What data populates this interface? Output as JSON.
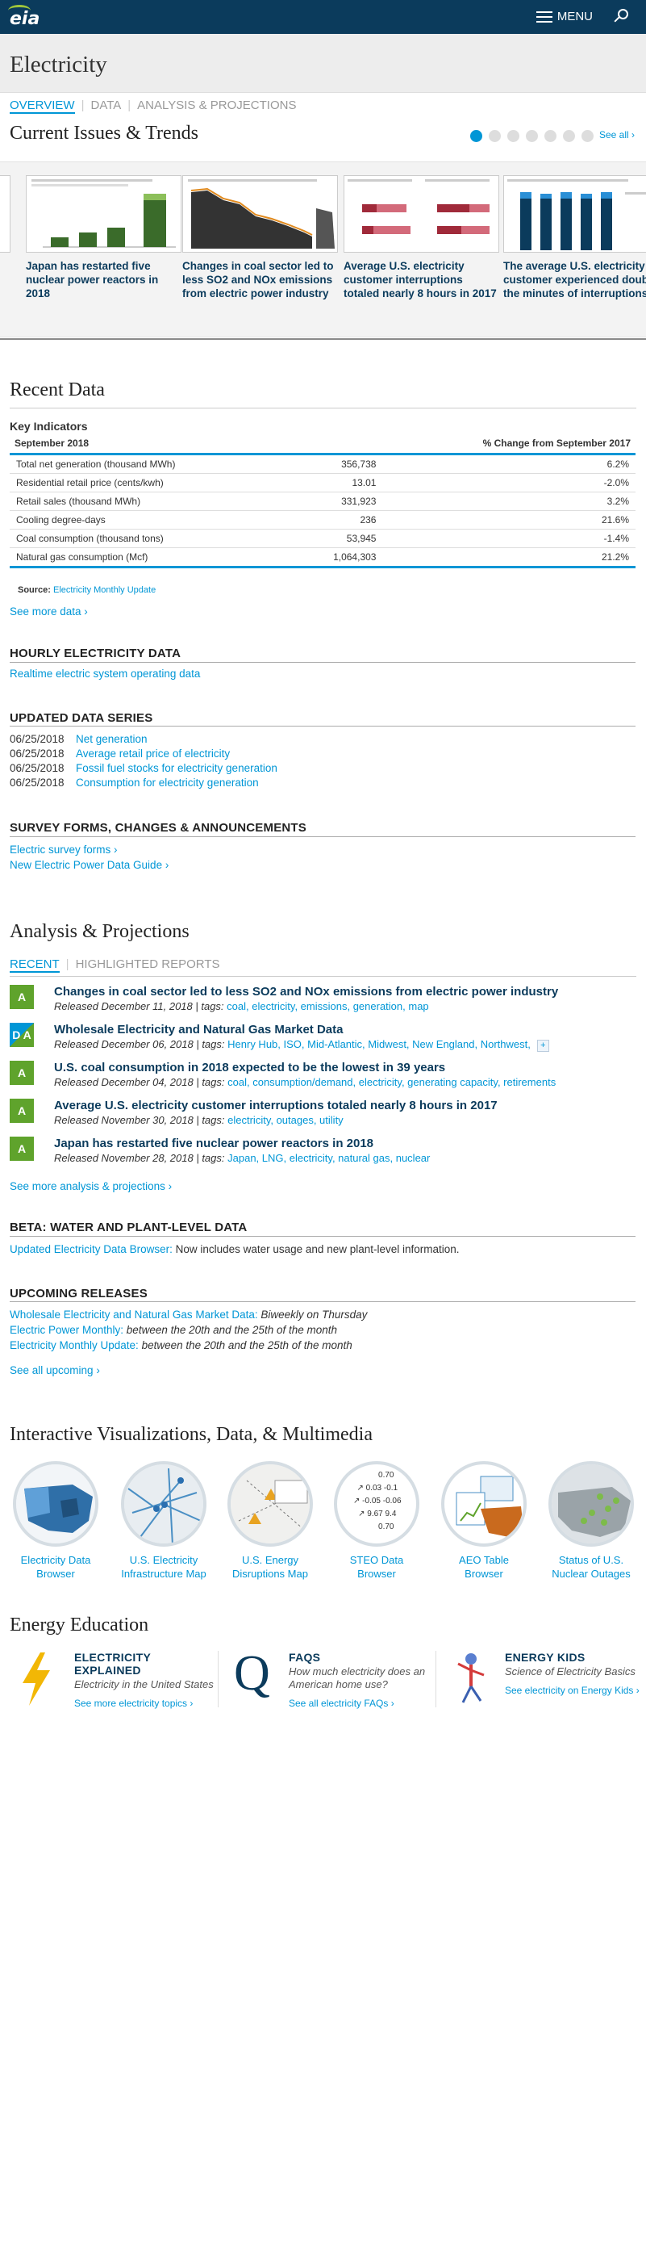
{
  "header": {
    "logo": "eia",
    "menu_label": "MENU"
  },
  "page_title": "Electricity",
  "subnav": {
    "overview": "OVERVIEW",
    "data": "DATA",
    "analysis": "ANALYSIS & PROJECTIONS"
  },
  "current_issues": {
    "title": "Current Issues & Trends",
    "see_all": "See all ›",
    "cards": [
      {
        "caption": "Japan has restarted five nuclear power reactors in 2018"
      },
      {
        "caption": "Changes in coal sector led to less SO2 and NOx emissions from electric power industry"
      },
      {
        "caption": "Average U.S. electricity customer interruptions totaled nearly 8 hours in 2017"
      },
      {
        "caption": "The average U.S. electricity customer experienced double the minutes of interruptions"
      }
    ]
  },
  "recent_data": {
    "title": "Recent Data",
    "key_indicators": {
      "title": "Key Indicators",
      "col_period": "September 2018",
      "col_change": "% Change from September 2017",
      "rows": [
        {
          "name": "Total net generation (thousand MWh)",
          "value": "356,738",
          "change": "6.2%"
        },
        {
          "name": "Residential retail price (cents/kwh)",
          "value": "13.01",
          "change": "-2.0%"
        },
        {
          "name": "Retail sales (thousand MWh)",
          "value": "331,923",
          "change": "3.2%"
        },
        {
          "name": "Cooling degree-days",
          "value": "236",
          "change": "21.6%"
        },
        {
          "name": "Coal consumption (thousand tons)",
          "value": "53,945",
          "change": "-1.4%"
        },
        {
          "name": "Natural gas consumption (Mcf)",
          "value": "1,064,303",
          "change": "21.2%"
        }
      ],
      "source_label": "Source:",
      "source_link": "Electricity Monthly Update"
    },
    "see_more": "See more data ›",
    "hourly": {
      "title": "HOURLY ELECTRICITY DATA",
      "link": "Realtime electric system operating data"
    },
    "updated": {
      "title": "UPDATED DATA SERIES",
      "rows": [
        {
          "date": "06/25/2018",
          "label": "Net generation"
        },
        {
          "date": "06/25/2018",
          "label": "Average retail price of electricity"
        },
        {
          "date": "06/25/2018",
          "label": "Fossil fuel stocks for electricity generation"
        },
        {
          "date": "06/25/2018",
          "label": "Consumption for electricity generation"
        }
      ]
    },
    "survey": {
      "title": "SURVEY FORMS, CHANGES & ANNOUNCEMENTS",
      "links": [
        "Electric survey forms ›",
        "New Electric Power Data Guide ›"
      ]
    }
  },
  "analysis": {
    "title": "Analysis & Projections",
    "tab_recent": "RECENT",
    "tab_highlighted": "HIGHLIGHTED REPORTS",
    "items": [
      {
        "badge": "A",
        "title": "Changes in coal sector led to less SO2 and NOx emissions from electric power industry",
        "released": "Released December 11, 2018 | tags:",
        "tags": "coal, electricity, emissions, generation, map"
      },
      {
        "badge": "D A",
        "title": "Wholesale Electricity and Natural Gas Market Data",
        "released": "Released December 06, 2018 | tags:",
        "tags": "Henry Hub, ISO, Mid-Atlantic, Midwest, New England, Northwest,"
      },
      {
        "badge": "A",
        "title": "U.S. coal consumption in 2018 expected to be the lowest in 39 years",
        "released": "Released December 04, 2018 | tags:",
        "tags": "coal, consumption/demand, electricity, generating capacity, retirements"
      },
      {
        "badge": "A",
        "title": "Average U.S. electricity customer interruptions totaled nearly 8 hours in 2017",
        "released": "Released November 30, 2018 | tags:",
        "tags": "electricity, outages, utility"
      },
      {
        "badge": "A",
        "title": "Japan has restarted five nuclear power reactors in 2018",
        "released": "Released November 28, 2018 | tags:",
        "tags": "Japan, LNG, electricity, natural gas, nuclear"
      }
    ],
    "see_more": "See more analysis & projections ›",
    "beta": {
      "title": "BETA: WATER AND PLANT-LEVEL DATA",
      "link": "Updated Electricity Data Browser:",
      "text": " Now includes water usage and new plant-level information."
    },
    "upcoming": {
      "title": "UPCOMING RELEASES",
      "rows": [
        {
          "link": "Wholesale Electricity and Natural Gas Market Data:",
          "text": " Biweekly on Thursday"
        },
        {
          "link": "Electric Power Monthly:",
          "text": " between the 20th and the 25th of the month"
        },
        {
          "link": "Electricity Monthly Update:",
          "text": " between the 20th and the 25th of the month"
        }
      ],
      "see_all": "See all upcoming ›"
    }
  },
  "interactive": {
    "title": "Interactive Visualizations, Data, & Multimedia",
    "items": [
      {
        "label": "Electricity Data Browser"
      },
      {
        "label": "U.S. Electricity Infrastructure Map"
      },
      {
        "label": "U.S. Energy Disruptions Map"
      },
      {
        "label": "STEO Data Browser",
        "values": [
          "0.70",
          "0.03",
          "-0.1",
          "-0.05",
          "-0.06",
          "9.67",
          "9.4",
          "0.70"
        ]
      },
      {
        "label": "AEO Table Browser"
      },
      {
        "label": "Status of U.S. Nuclear Outages"
      }
    ]
  },
  "education": {
    "title": "Energy Education",
    "items": [
      {
        "title": "ELECTRICITY EXPLAINED",
        "subtitle": "Electricity in the United States",
        "link": "See more electricity topics ›"
      },
      {
        "title": "FAQS",
        "subtitle": "How much electricity does an American home use?",
        "link": "See all electricity FAQs ›"
      },
      {
        "title": "ENERGY KIDS",
        "subtitle": "Science of Electricity Basics",
        "link": "See electricity on Energy Kids ›"
      }
    ]
  },
  "colors": {
    "header_bg": "#0b3b5c",
    "accent": "#0096d6",
    "badge_green": "#5fa32c"
  }
}
